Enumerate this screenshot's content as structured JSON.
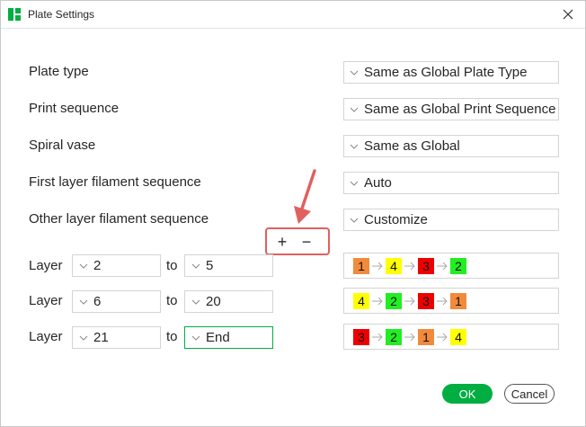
{
  "window": {
    "title": "Plate Settings"
  },
  "settings": [
    {
      "label": "Plate type",
      "value": "Same as Global Plate Type"
    },
    {
      "label": "Print sequence",
      "value": "Same as Global Print Sequence"
    },
    {
      "label": "Spiral vase",
      "value": "Same as Global"
    },
    {
      "label": "First layer filament sequence",
      "value": "Auto"
    },
    {
      "label": "Other layer filament sequence",
      "value": "Customize"
    }
  ],
  "controls": {
    "add": "+",
    "remove": "−"
  },
  "layers": [
    {
      "label": "Layer",
      "from": "2",
      "to_label": "to",
      "to": "5",
      "sequence": [
        {
          "n": "1",
          "color": "#f28a3c"
        },
        {
          "n": "4",
          "color": "#ffff00"
        },
        {
          "n": "3",
          "color": "#ee0000"
        },
        {
          "n": "2",
          "color": "#22ee22"
        }
      ]
    },
    {
      "label": "Layer",
      "from": "6",
      "to_label": "to",
      "to": "20",
      "sequence": [
        {
          "n": "4",
          "color": "#ffff00"
        },
        {
          "n": "2",
          "color": "#22ee22"
        },
        {
          "n": "3",
          "color": "#ee0000"
        },
        {
          "n": "1",
          "color": "#f28a3c"
        }
      ]
    },
    {
      "label": "Layer",
      "from": "21",
      "to_label": "to",
      "to": "End",
      "sequence": [
        {
          "n": "3",
          "color": "#ee0000"
        },
        {
          "n": "2",
          "color": "#22ee22"
        },
        {
          "n": "1",
          "color": "#f28a3c"
        },
        {
          "n": "4",
          "color": "#ffff00"
        }
      ]
    }
  ],
  "buttons": {
    "ok": "OK",
    "cancel": "Cancel"
  },
  "colors": {
    "accent": "#00ae42",
    "highlight": "#e06060"
  }
}
